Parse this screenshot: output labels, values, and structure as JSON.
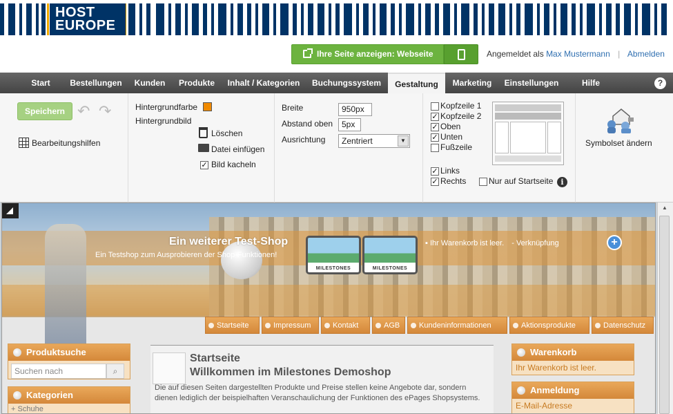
{
  "brand": {
    "logo_line1": "HOST",
    "logo_line2": "EUROPE",
    "primary_color": "#003366",
    "accent_color": "#f2a900"
  },
  "topbar": {
    "view_button": "Ihre Seite anzeigen: Webseite",
    "mobile_icon": "mobile-phone-icon",
    "logged_in_label": "Angemeldet als",
    "user_name": "Max Mustermann",
    "logout": "Abmelden"
  },
  "nav": {
    "items": [
      "Start",
      "Bestellungen",
      "Kunden",
      "Produkte",
      "Inhalt / Kategorien",
      "Buchungssystem",
      "Gestaltung",
      "Marketing",
      "Einstellungen",
      "Hilfe"
    ],
    "active": "Gestaltung",
    "help": "?"
  },
  "toolbar": {
    "save": "Speichern",
    "editing_aids": "Bearbeitungshilfen",
    "background_color": "Hintergrundfarbe",
    "background_color_value": "#f08a00",
    "background_image": "Hintergrundbild",
    "delete": "Löschen",
    "insert_file": "Datei einfügen",
    "tile_image": "Bild kacheln",
    "tile_image_checked": "✓",
    "width_label": "Breite",
    "width_value": "950px",
    "top_margin_label": "Abstand oben",
    "top_margin_value": "5px",
    "alignment_label": "Ausrichtung",
    "alignment_value": "Zentriert",
    "regions": {
      "header1": {
        "label": "Kopfzeile 1",
        "mark": ""
      },
      "header2": {
        "label": "Kopfzeile 2",
        "mark": "✓"
      },
      "top": {
        "label": "Oben",
        "mark": "✓"
      },
      "bottom": {
        "label": "Unten",
        "mark": "✓"
      },
      "footer": {
        "label": "Fußzeile",
        "mark": ""
      },
      "left": {
        "label": "Links",
        "mark": "✓"
      },
      "right": {
        "label": "Rechts",
        "mark": "✓"
      },
      "start_only": {
        "label": "Nur auf Startseite",
        "mark": ""
      }
    },
    "info": "i",
    "symbolset": "Symbolset ändern"
  },
  "preview": {
    "shop_title": "Ein weiterer Test-Shop",
    "shop_subtitle": "Ein Testshop zum Ausprobieren der Shop-Funktionen!",
    "logo_text": "MILESTONES",
    "cart_status": "Ihr Warenkorb ist leer.",
    "links": "- Verknüpfung",
    "plus": "+",
    "menu": [
      "Startseite",
      "Impressum",
      "Kontakt",
      "AGB",
      "Kundeninformationen",
      "Aktionsprodukte",
      "Datenschutz"
    ],
    "product_search": "Produktsuche",
    "search_placeholder": "Suchen nach",
    "search_icon": "magnifier-icon",
    "categories": "Kategorien",
    "category_item": "Schuhe",
    "expand": "+",
    "page_title": "Startseite",
    "welcome": "Willkommen im Milestones Demoshop",
    "body_text": "Die auf diesen Seiten dargestellten Produkte und Preise stellen keine Angebote dar, sondern dienen lediglich der beispielhaften Veranschaulichung der Funktionen des ePages Shopsystems.",
    "cart_box": "Warenkorb",
    "cart_box_text": "Ihr Warenkorb ist leer.",
    "login_box": "Anmeldung",
    "email_label": "E-Mail-Adresse",
    "scroll_up": "▲"
  }
}
